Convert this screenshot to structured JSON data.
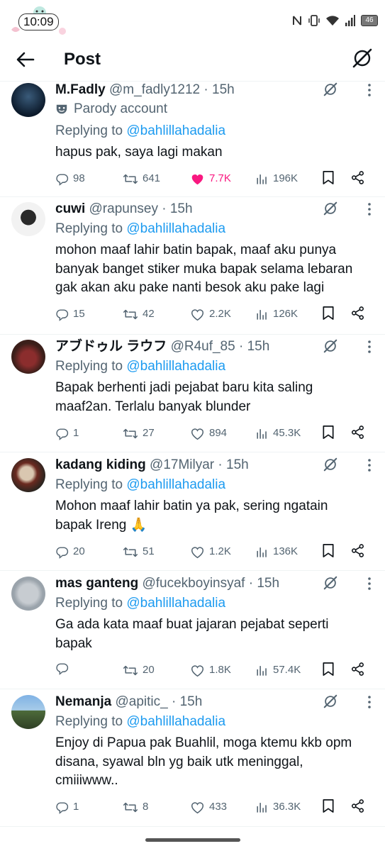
{
  "status_bar": {
    "time": "10:09",
    "battery": "46"
  },
  "header": {
    "title": "Post"
  },
  "replies": [
    {
      "name": "M.Fadly",
      "handle": "@m_fadly1212",
      "age": "15h",
      "parody": "Parody account",
      "replying_prefix": "Replying to",
      "replying_to": "@bahlillahadalia",
      "text": "hapus pak, saya lagi makan",
      "replies": "98",
      "reposts": "641",
      "likes": "7.7K",
      "views": "196K",
      "liked": true
    },
    {
      "name": "cuwi",
      "handle": "@rapunsey",
      "age": "15h",
      "replying_prefix": "Replying to",
      "replying_to": "@bahlillahadalia",
      "text": "mohon maaf lahir batin bapak, maaf aku punya banyak banget stiker muka bapak selama lebaran gak akan aku pake nanti besok aku pake lagi",
      "replies": "15",
      "reposts": "42",
      "likes": "2.2K",
      "views": "126K"
    },
    {
      "name": "アブドゥル ラウフ",
      "handle": "@R4uf_85",
      "age": "15h",
      "replying_prefix": "Replying to",
      "replying_to": "@bahlillahadalia",
      "text": "Bapak berhenti jadi pejabat baru kita saling maaf2an. Terlalu banyak blunder",
      "replies": "1",
      "reposts": "27",
      "likes": "894",
      "views": "45.3K"
    },
    {
      "name": "kadang kiding",
      "handle": "@17Milyar",
      "age": "15h",
      "replying_prefix": "Replying to",
      "replying_to": "@bahlillahadalia",
      "text": "Mohon maaf lahir batin ya pak, sering ngatain bapak Ireng 🙏",
      "replies": "20",
      "reposts": "51",
      "likes": "1.2K",
      "views": "136K"
    },
    {
      "name": "mas ganteng",
      "handle": "@fucekboyinsyaf",
      "age": "15h",
      "replying_prefix": "Replying to",
      "replying_to": "@bahlillahadalia",
      "text": "Ga ada kata maaf buat jajaran pejabat seperti bapak",
      "replies": "",
      "reposts": "20",
      "likes": "1.8K",
      "views": "57.4K"
    },
    {
      "name": "Nemanja",
      "handle": "@apitic_",
      "age": "15h",
      "replying_prefix": "Replying to",
      "replying_to": "@bahlillahadalia",
      "text": "Enjoy di Papua pak Buahlil, moga ktemu kkb opm disana, syawal bln yg baik utk meninggal, cmiiiwww..",
      "replies": "1",
      "reposts": "8",
      "likes": "433",
      "views": "36.3K"
    }
  ],
  "colors": {
    "accent": "#1d9bf0",
    "like": "#f91880",
    "muted": "#536471"
  }
}
